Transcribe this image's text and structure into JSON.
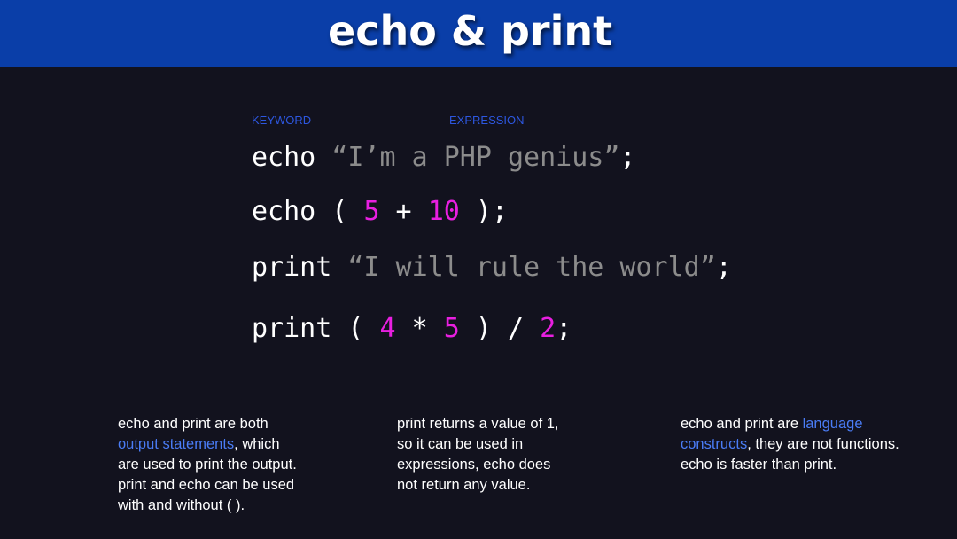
{
  "slide": {
    "title": "echo & print"
  },
  "labels": {
    "keyword": "KEYWORD",
    "expression": "EXPRESSION"
  },
  "code_lines": [
    {
      "kw": "echo",
      "s1": " ",
      "str": "“I’m a PHP genius”",
      "tail": ";"
    },
    {
      "kw": "echo",
      "p1": " ( ",
      "n1": "5",
      "op1": " + ",
      "n2": "10",
      "tail": " );"
    },
    {
      "kw": "print",
      "s1": " ",
      "str": "“I will rule the world”",
      "tail": ";"
    },
    {
      "kw": "print",
      "p1": " ( ",
      "n1": "4",
      "op1": " * ",
      "n2": "5",
      "op2": " ) / ",
      "n3": "2",
      "tail": ";"
    }
  ],
  "notes": {
    "left": {
      "pre": "echo and print are both\n",
      "hl": "output statements",
      "post": ", which\nare used to print the output.\nprint and echo can be used\nwith and without ( )."
    },
    "middle": {
      "text": "print returns a value of 1,\nso it can be used in\nexpressions, echo does\nnot return any value."
    },
    "right": {
      "pre": "echo and print are ",
      "hl": "language\nconstructs",
      "post": ", they are not functions.\necho is faster than print."
    }
  },
  "colors": {
    "header": "#0a3ea8",
    "background": "#12121e",
    "string": "#8c8c8c",
    "number": "#e81fe0",
    "highlight": "#4a7cf5",
    "label": "#2d57e0"
  }
}
